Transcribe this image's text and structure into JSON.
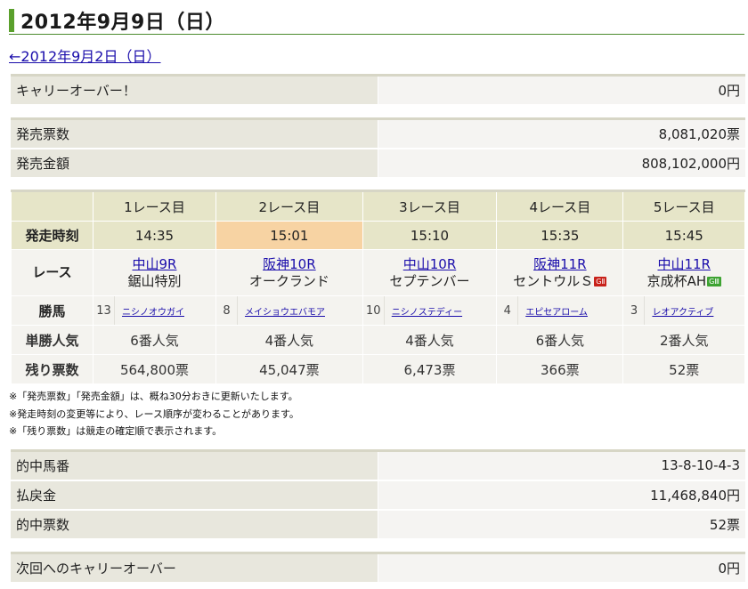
{
  "title": "2012年9月9日（日）",
  "prev_link": "←2012年9月2日（日）",
  "carryover": {
    "label": "キャリーオーバー！",
    "value": "0円"
  },
  "sales": [
    {
      "label": "発売票数",
      "value": "8,081,020票"
    },
    {
      "label": "発売金額",
      "value": "808,102,000円"
    }
  ],
  "race_table": {
    "headers": [
      "1レース目",
      "2レース目",
      "3レース目",
      "4レース目",
      "5レース目"
    ],
    "row_labels": {
      "time": "発走時刻",
      "race": "レース",
      "winner": "勝馬",
      "popularity": "単勝人気",
      "remaining": "残り票数"
    },
    "races": [
      {
        "time": "14:35",
        "venue": "中山9R",
        "name": "鋸山特別",
        "grade": "",
        "horse_no": "13",
        "horse": "ニシノオウガイ",
        "popularity": "6番人気",
        "remaining": "564,800票"
      },
      {
        "time": "15:01",
        "venue": "阪神10R",
        "name": "オークランド",
        "grade": "",
        "horse_no": "8",
        "horse": "メイショウエバモア",
        "popularity": "4番人気",
        "remaining": "45,047票"
      },
      {
        "time": "15:10",
        "venue": "中山10R",
        "name": "セプテンバー",
        "grade": "",
        "horse_no": "10",
        "horse": "ニシノステディー",
        "popularity": "4番人気",
        "remaining": "6,473票"
      },
      {
        "time": "15:35",
        "venue": "阪神11R",
        "name": "セントウルＳ",
        "grade": "GⅡ",
        "horse_no": "4",
        "horse": "エピセアローム",
        "popularity": "6番人気",
        "remaining": "366票"
      },
      {
        "time": "15:45",
        "venue": "中山11R",
        "name": "京成杯AH",
        "grade": "GⅢ",
        "horse_no": "3",
        "horse": "レオアクティブ",
        "popularity": "2番人気",
        "remaining": "52票"
      }
    ]
  },
  "notes": [
    "※「発売票数」「発売金額」は、概ね30分おきに更新いたします。",
    "※発走時刻の変更等により、レース順序が変わることがあります。",
    "※「残り票数」は競走の確定順で表示されます。"
  ],
  "results": [
    {
      "label": "的中馬番",
      "value": "13-8-10-4-3"
    },
    {
      "label": "払戻金",
      "value": "11,468,840円"
    },
    {
      "label": "的中票数",
      "value": "52票"
    }
  ],
  "next_carryover": {
    "label": "次回へのキャリーオーバー",
    "value": "0円"
  }
}
